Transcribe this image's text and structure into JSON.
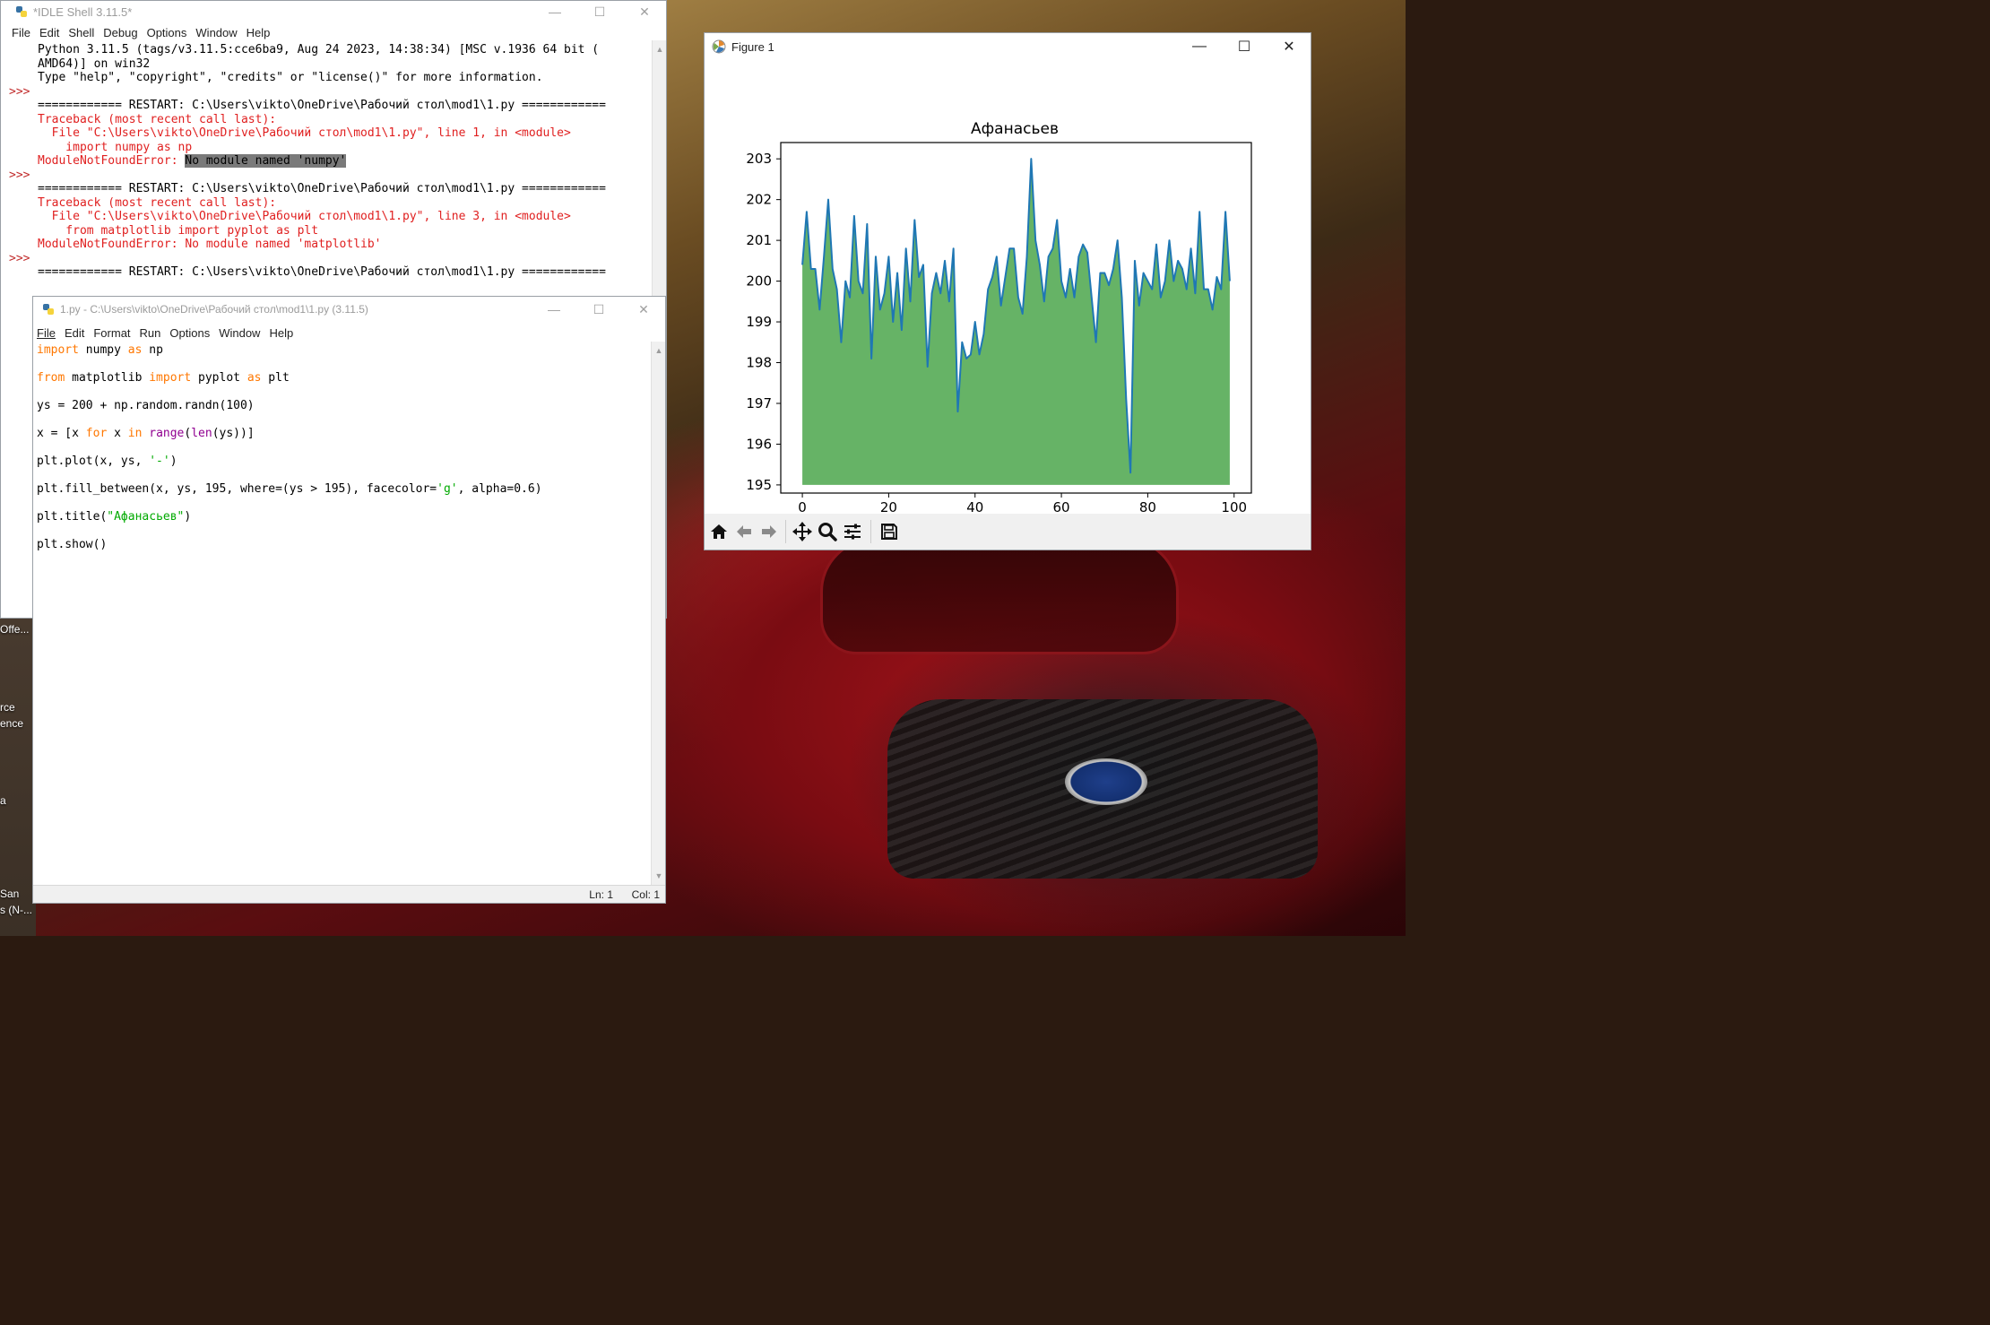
{
  "desktop": {
    "icon_labels": [
      "Offe...",
      "rce",
      "ence",
      "a",
      "San",
      "s (N-..."
    ]
  },
  "shell": {
    "title": "*IDLE Shell 3.11.5*",
    "menu": [
      "File",
      "Edit",
      "Shell",
      "Debug",
      "Options",
      "Window",
      "Help"
    ],
    "prompt": ">>>",
    "lines": {
      "l1": "Python 3.11.5 (tags/v3.11.5:cce6ba9, Aug 24 2023, 14:38:34) [MSC v.1936 64 bit (",
      "l2": "AMD64)] on win32",
      "l3": "Type \"help\", \"copyright\", \"credits\" or \"license()\" for more information.",
      "restart": "============ RESTART: C:\\Users\\vikto\\OneDrive\\Рабочий стол\\mod1\\1.py ============",
      "tb": "Traceback (most recent call last):",
      "file1": "  File \"C:\\Users\\vikto\\OneDrive\\Рабочий стол\\mod1\\1.py\", line 1, in <module>",
      "code1": "    import numpy as np",
      "err1_prefix": "ModuleNotFoundError: ",
      "err1_msg": "No module named 'numpy'",
      "file2": "  File \"C:\\Users\\vikto\\OneDrive\\Рабочий стол\\mod1\\1.py\", line 3, in <module>",
      "code2": "    from matplotlib import pyplot as plt",
      "err2": "ModuleNotFoundError: No module named 'matplotlib'"
    }
  },
  "editor": {
    "title": "1.py - C:\\Users\\vikto\\OneDrive\\Рабочий стол\\mod1\\1.py (3.11.5)",
    "menu": [
      "File",
      "Edit",
      "Format",
      "Run",
      "Options",
      "Window",
      "Help"
    ],
    "code": {
      "l1_kw1": "import",
      "l1_a": " numpy ",
      "l1_kw2": "as",
      "l1_b": " np",
      "l2_kw1": "from",
      "l2_a": " matplotlib ",
      "l2_kw2": "import",
      "l2_b": " pyplot ",
      "l2_kw3": "as",
      "l2_c": " plt",
      "l3": "ys = 200 + np.random.randn(100)",
      "l4_a": "x = [x ",
      "l4_kw1": "for",
      "l4_b": " x ",
      "l4_kw2": "in",
      "l4_c": " ",
      "l4_bi1": "range",
      "l4_d": "(",
      "l4_bi2": "len",
      "l4_e": "(ys))]",
      "l5_a": "plt.plot(x, ys, ",
      "l5_str": "'-'",
      "l5_b": ")",
      "l6_a": "plt.fill_between(x, ys, 195, where=(ys > 195), facecolor=",
      "l6_str": "'g'",
      "l6_b": ", alpha=0.6)",
      "l7_a": "plt.title(",
      "l7_str": "\"Афанасьев\"",
      "l7_b": ")",
      "l8": "plt.show()"
    },
    "status": {
      "ln": "Ln: 1",
      "col": "Col: 1"
    }
  },
  "figure": {
    "title": "Figure 1"
  },
  "chart_data": {
    "type": "area",
    "title": "Афанасьев",
    "xlabel": "",
    "ylabel": "",
    "xlim": [
      -5,
      104
    ],
    "ylim": [
      194.8,
      203.4
    ],
    "xticks": [
      0,
      20,
      40,
      60,
      80,
      100
    ],
    "yticks": [
      195,
      196,
      197,
      198,
      199,
      200,
      201,
      202,
      203
    ],
    "fill_baseline": 195,
    "line_color": "#1f77b4",
    "fill_color": "#008000",
    "fill_alpha": 0.6,
    "x": [
      0,
      1,
      2,
      3,
      4,
      5,
      6,
      7,
      8,
      9,
      10,
      11,
      12,
      13,
      14,
      15,
      16,
      17,
      18,
      19,
      20,
      21,
      22,
      23,
      24,
      25,
      26,
      27,
      28,
      29,
      30,
      31,
      32,
      33,
      34,
      35,
      36,
      37,
      38,
      39,
      40,
      41,
      42,
      43,
      44,
      45,
      46,
      47,
      48,
      49,
      50,
      51,
      52,
      53,
      54,
      55,
      56,
      57,
      58,
      59,
      60,
      61,
      62,
      63,
      64,
      65,
      66,
      67,
      68,
      69,
      70,
      71,
      72,
      73,
      74,
      75,
      76,
      77,
      78,
      79,
      80,
      81,
      82,
      83,
      84,
      85,
      86,
      87,
      88,
      89,
      90,
      91,
      92,
      93,
      94,
      95,
      96,
      97,
      98,
      99
    ],
    "values": [
      200.4,
      201.7,
      200.3,
      200.3,
      199.3,
      200.6,
      202.0,
      200.3,
      199.8,
      198.5,
      200.0,
      199.6,
      201.6,
      200.0,
      199.7,
      201.4,
      198.1,
      200.6,
      199.3,
      199.7,
      200.6,
      199.0,
      200.2,
      198.8,
      200.8,
      199.5,
      201.5,
      200.1,
      200.4,
      197.9,
      199.7,
      200.2,
      199.7,
      200.5,
      199.5,
      200.8,
      196.8,
      198.5,
      198.1,
      198.2,
      199.0,
      198.2,
      198.7,
      199.8,
      200.1,
      200.6,
      199.4,
      200.1,
      200.8,
      200.8,
      199.6,
      199.2,
      200.6,
      203.0,
      201.0,
      200.4,
      199.5,
      200.6,
      200.8,
      201.5,
      200.0,
      199.6,
      200.3,
      199.6,
      200.6,
      200.9,
      200.7,
      199.6,
      198.5,
      200.2,
      200.2,
      199.9,
      200.3,
      201.0,
      199.6,
      197.1,
      195.3,
      200.5,
      199.4,
      200.2,
      200.0,
      199.8,
      200.9,
      199.6,
      200.0,
      201.0,
      200.0,
      200.5,
      200.3,
      199.8,
      200.8,
      199.7,
      201.7,
      199.8,
      199.8,
      199.3,
      200.1,
      199.8,
      201.7,
      200.0
    ]
  }
}
